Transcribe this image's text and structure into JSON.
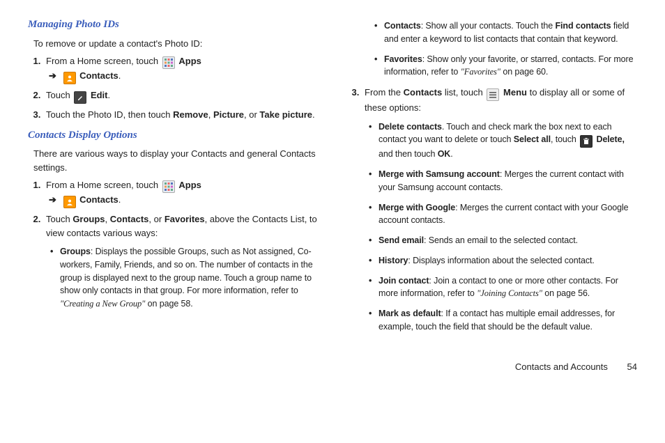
{
  "sections": {
    "photo_ids": {
      "title": "Managing Photo IDs",
      "intro": "To remove or update a contact's Photo ID:",
      "step1_a": "From a Home screen, touch ",
      "step1_apps": "Apps",
      "step1_contacts": "Contacts",
      "step2_a": "Touch ",
      "step2_edit": "Edit",
      "step3_a": "Touch the Photo ID, then touch ",
      "step3_remove": "Remove",
      "step3_b": ", ",
      "step3_picture": "Picture",
      "step3_c": ", or ",
      "step3_take": "Take picture",
      "step3_d": "."
    },
    "display_options": {
      "title": "Contacts Display Options",
      "intro": "There are various ways to display your Contacts and general Contacts settings.",
      "step1_a": "From a Home screen, touch ",
      "step1_apps": "Apps",
      "step1_contacts": "Contacts",
      "step2_a": "Touch ",
      "step2_groups": "Groups",
      "step2_b": ", ",
      "step2_contacts": "Contacts",
      "step2_c": ", or ",
      "step2_favorites": "Favorites",
      "step2_d": ", above the Contacts List, to view contacts various ways:",
      "bullet_groups_label": "Groups",
      "bullet_groups_text": ": Displays the possible Groups, such as Not assigned, Co-workers, Family, Friends, and so on. The number of contacts in the group is displayed next to the group name. Touch a group name to show only contacts in that group. For more information, refer to ",
      "bullet_groups_ref": "\"Creating a New Group\"",
      "bullet_groups_page": " on page 58.",
      "bullet_contacts_label": "Contacts",
      "bullet_contacts_text_a": ": Show all your contacts. Touch the ",
      "bullet_contacts_find": "Find contacts",
      "bullet_contacts_text_b": " field and enter a keyword to list contacts that contain that keyword.",
      "bullet_favorites_label": "Favorites",
      "bullet_favorites_text": ": Show only your favorite, or starred, contacts. For more information, refer to ",
      "bullet_favorites_ref": "\"Favorites\"",
      "bullet_favorites_page": " on page 60.",
      "step3_a": "From the ",
      "step3_contacts": "Contacts",
      "step3_b": " list, touch ",
      "step3_menu": "Menu",
      "step3_c": " to display all or some of these options:",
      "opt_delete_label": "Delete contacts",
      "opt_delete_text_a": ". Touch and check mark the box next to each contact you want to delete or touch ",
      "opt_delete_selectall": "Select all",
      "opt_delete_text_b": ", touch ",
      "opt_delete_delete": "Delete,",
      "opt_delete_text_c": " and then touch ",
      "opt_delete_ok": "OK",
      "opt_delete_text_d": ".",
      "opt_merge_samsung_label": "Merge with Samsung account",
      "opt_merge_samsung_text": ": Merges the current contact with your Samsung account contacts.",
      "opt_merge_google_label": "Merge with Google",
      "opt_merge_google_text": ": Merges the current contact with your Google account contacts.",
      "opt_send_email_label": "Send email",
      "opt_send_email_text": ": Sends an email to the selected contact.",
      "opt_history_label": "History",
      "opt_history_text": ": Displays information about the selected contact.",
      "opt_join_label": "Join contact",
      "opt_join_text": ": Join a contact to one or more other contacts. For more information, refer to ",
      "opt_join_ref": "\"Joining Contacts\"",
      "opt_join_page": " on page 56.",
      "opt_mark_label": "Mark as default",
      "opt_mark_text": ": If a contact has multiple email addresses, for example, touch the field that should be the default value."
    }
  },
  "footer": {
    "section": "Contacts and Accounts",
    "page": "54"
  },
  "arrow": "➔"
}
